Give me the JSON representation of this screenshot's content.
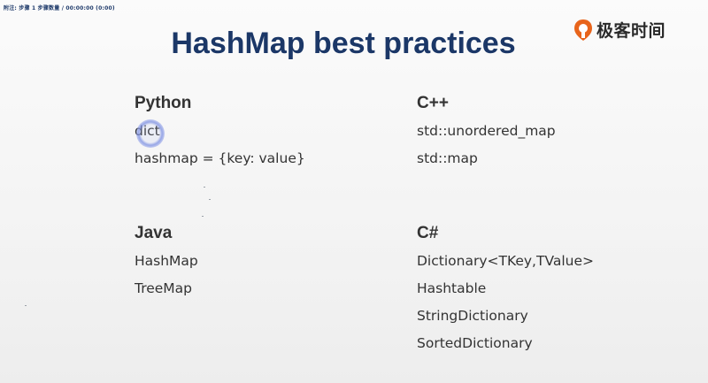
{
  "window": {
    "top_bar_text": "附注: 步骤 1 步骤数量 / 00:00:00 (0:00)"
  },
  "brand": {
    "logo_text": "极客时间",
    "logo_color": "#e8641b"
  },
  "slide": {
    "title": "HashMap best practices",
    "title_color": "#1b3767",
    "sections": [
      {
        "heading": "Python",
        "items": [
          "dict",
          "hashmap = {key: value}"
        ]
      },
      {
        "heading": "C++",
        "items": [
          "std::unordered_map",
          "std::map"
        ]
      },
      {
        "heading": "Java",
        "items": [
          "HashMap",
          "TreeMap"
        ]
      },
      {
        "heading": "C#",
        "items": [
          "Dictionary<TKey,TValue>",
          "Hashtable",
          "StringDictionary",
          "SortedDictionary"
        ]
      }
    ]
  }
}
